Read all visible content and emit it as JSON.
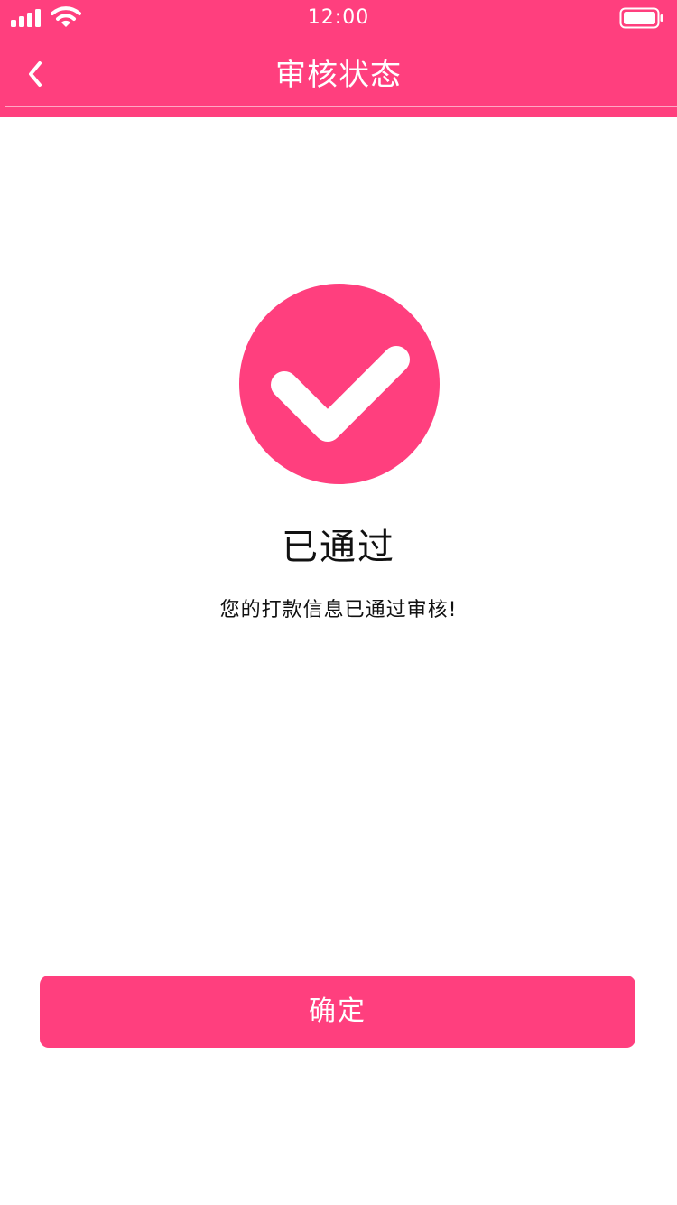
{
  "colors": {
    "accent": "#ff3f7e",
    "background": "#ffffff",
    "text": "#111111",
    "on_accent": "#ffffff"
  },
  "status_bar": {
    "time": "12:00",
    "icons": [
      "signal-icon",
      "wifi-icon",
      "battery-icon"
    ]
  },
  "nav": {
    "title": "审核状态",
    "back_icon": "chevron-left-icon"
  },
  "result": {
    "icon": "check-circle-icon",
    "title": "已通过",
    "message": "您的打款信息已通过审核!"
  },
  "actions": {
    "confirm_label": "确定"
  }
}
